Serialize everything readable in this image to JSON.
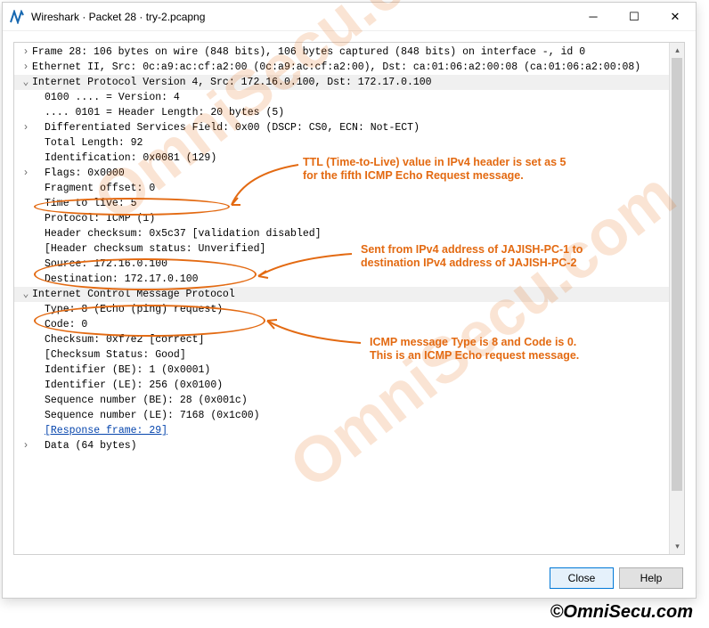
{
  "window": {
    "title": "Wireshark · Packet 28 · try-2.pcapng"
  },
  "tree": {
    "frame": "Frame 28: 106 bytes on wire (848 bits), 106 bytes captured (848 bits) on interface -, id 0",
    "ethernet": "Ethernet II, Src: 0c:a9:ac:cf:a2:00 (0c:a9:ac:cf:a2:00), Dst: ca:01:06:a2:00:08 (ca:01:06:a2:00:08)",
    "ipv4_header": "Internet Protocol Version 4, Src: 172.16.0.100, Dst: 172.17.0.100",
    "ipv4": {
      "version": "0100 .... = Version: 4",
      "hdrlen": ".... 0101 = Header Length: 20 bytes (5)",
      "dsf": "Differentiated Services Field: 0x00 (DSCP: CS0, ECN: Not-ECT)",
      "totlen": "Total Length: 92",
      "ident": "Identification: 0x0081 (129)",
      "flags": "Flags: 0x0000",
      "fragoff": "Fragment offset: 0",
      "ttl": "Time to live: 5",
      "proto": "Protocol: ICMP (1)",
      "hdrchk": "Header checksum: 0x5c37 [validation disabled]",
      "hdrchkstat": "[Header checksum status: Unverified]",
      "src": "Source: 172.16.0.100",
      "dst": "Destination: 172.17.0.100"
    },
    "icmp_header": "Internet Control Message Protocol",
    "icmp": {
      "type": "Type: 8 (Echo (ping) request)",
      "code": "Code: 0",
      "chk": "Checksum: 0xf7e2 [correct]",
      "chkstat": "[Checksum Status: Good]",
      "idbe": "Identifier (BE): 1 (0x0001)",
      "idle": "Identifier (LE): 256 (0x0100)",
      "seqbe": "Sequence number (BE): 28 (0x001c)",
      "seqle": "Sequence number (LE): 7168 (0x1c00)",
      "resp": "[Response frame: 29]",
      "data": "Data (64 bytes)"
    }
  },
  "annotations": {
    "ttl1": "TTL (Time-to-Live) value in IPv4 header is set as 5",
    "ttl2": "for the  fifth ICMP Echo Request message.",
    "addr1": "Sent from IPv4 address of JAJISH-PC-1 to",
    "addr2": "destination IPv4 address of  JAJISH-PC-2",
    "icmp1": "ICMP message Type is 8 and Code is 0.",
    "icmp2": "This is an ICMP Echo request message."
  },
  "watermark": "OmniSecu.com",
  "buttons": {
    "close": "Close",
    "help": "Help"
  },
  "footer": "©OmniSecu.com"
}
